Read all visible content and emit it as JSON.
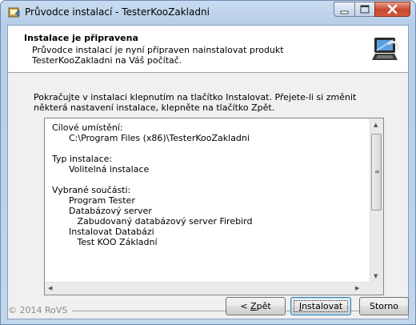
{
  "window": {
    "title": "Průvodce instalací - TesterKooZakladni",
    "controls": {
      "minimize": "minimize",
      "maximize": "maximize",
      "close": "close"
    }
  },
  "header": {
    "title": "Instalace je připravena",
    "description": "Průvodce instalací je nyní připraven nainstalovat produkt TesterKooZakladni na Váš počítač."
  },
  "body": {
    "intro": "Pokračujte v instalaci klepnutím na tlačítko Instalovat. Přejete-li si změnit některá nastavení instalace, klepněte na tlačítko Zpět.",
    "memo_lines": [
      "Cílové umístění:",
      "      C:\\Program Files (x86)\\TesterKooZakladni",
      "",
      "Typ instalace:",
      "      Volitelná instalace",
      "",
      "Vybrané součásti:",
      "      Program Tester",
      "      Databázový server",
      "         Zabudovaný databázový server Firebird",
      "      Instalovat Databázi",
      "         Test KOO Základní"
    ]
  },
  "footer": {
    "copyright": "© 2014 RoVS"
  },
  "buttons": {
    "back": {
      "prefix": "< ",
      "accel": "Z",
      "rest": "pět"
    },
    "install": {
      "accel": "I",
      "rest": "nstalovat"
    },
    "cancel": "Storno"
  },
  "colors": {
    "title_bar": "#b9d1ea",
    "close_button": "#c7462c",
    "default_button_border": "#3c7fb1"
  },
  "icons": [
    "installer-app-icon",
    "setup-computer-icon",
    "minimize-icon",
    "maximize-icon",
    "close-icon"
  ]
}
